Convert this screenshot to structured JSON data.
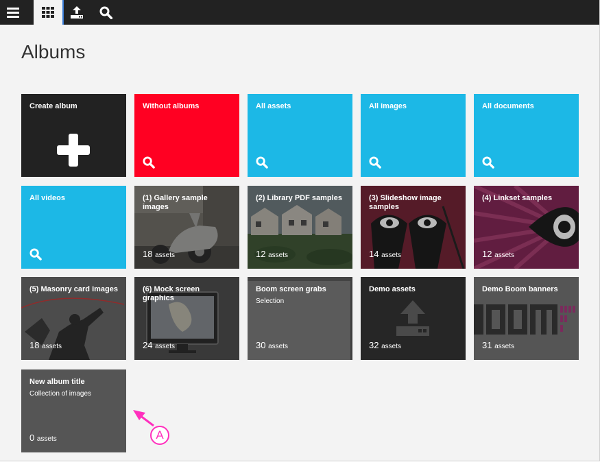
{
  "page": {
    "title": "Albums"
  },
  "toolbar": {
    "menu_icon": "hamburger-menu-icon",
    "grid_icon": "grid-icon",
    "upload_icon": "upload-icon",
    "search_icon": "search-icon"
  },
  "colors": {
    "dark_tile": "#222222",
    "red_tile": "#ff0022",
    "blue_tile": "#1cb8e6",
    "gray_tile": "#555555",
    "annotation": "#ff2fbd"
  },
  "tiles": [
    {
      "title": "Create album"
    },
    {
      "title": "Without albums"
    },
    {
      "title": "All assets"
    },
    {
      "title": "All images"
    },
    {
      "title": "All documents"
    },
    {
      "title": "All videos"
    },
    {
      "title": "(1) Gallery sample images",
      "count": "18",
      "unit": "assets"
    },
    {
      "title": "(2) Library PDF samples",
      "count": "12",
      "unit": "assets"
    },
    {
      "title": "(3) Slideshow image samples",
      "count": "14",
      "unit": "assets"
    },
    {
      "title": "(4) Linkset samples",
      "count": "12",
      "unit": "assets"
    },
    {
      "title": "(5) Masonry card images",
      "count": "18",
      "unit": "assets"
    },
    {
      "title": "(6) Mock screen graphics",
      "count": "24",
      "unit": "assets"
    },
    {
      "title": "Boom screen grabs",
      "subtitle": "Selection",
      "count": "30",
      "unit": "assets"
    },
    {
      "title": "Demo assets",
      "count": "32",
      "unit": "assets"
    },
    {
      "title": "Demo Boom banners",
      "count": "31",
      "unit": "assets"
    },
    {
      "title": "New album title",
      "subtitle": "Collection of images",
      "count": "0",
      "unit": "assets"
    }
  ],
  "annotation": {
    "label": "A"
  }
}
